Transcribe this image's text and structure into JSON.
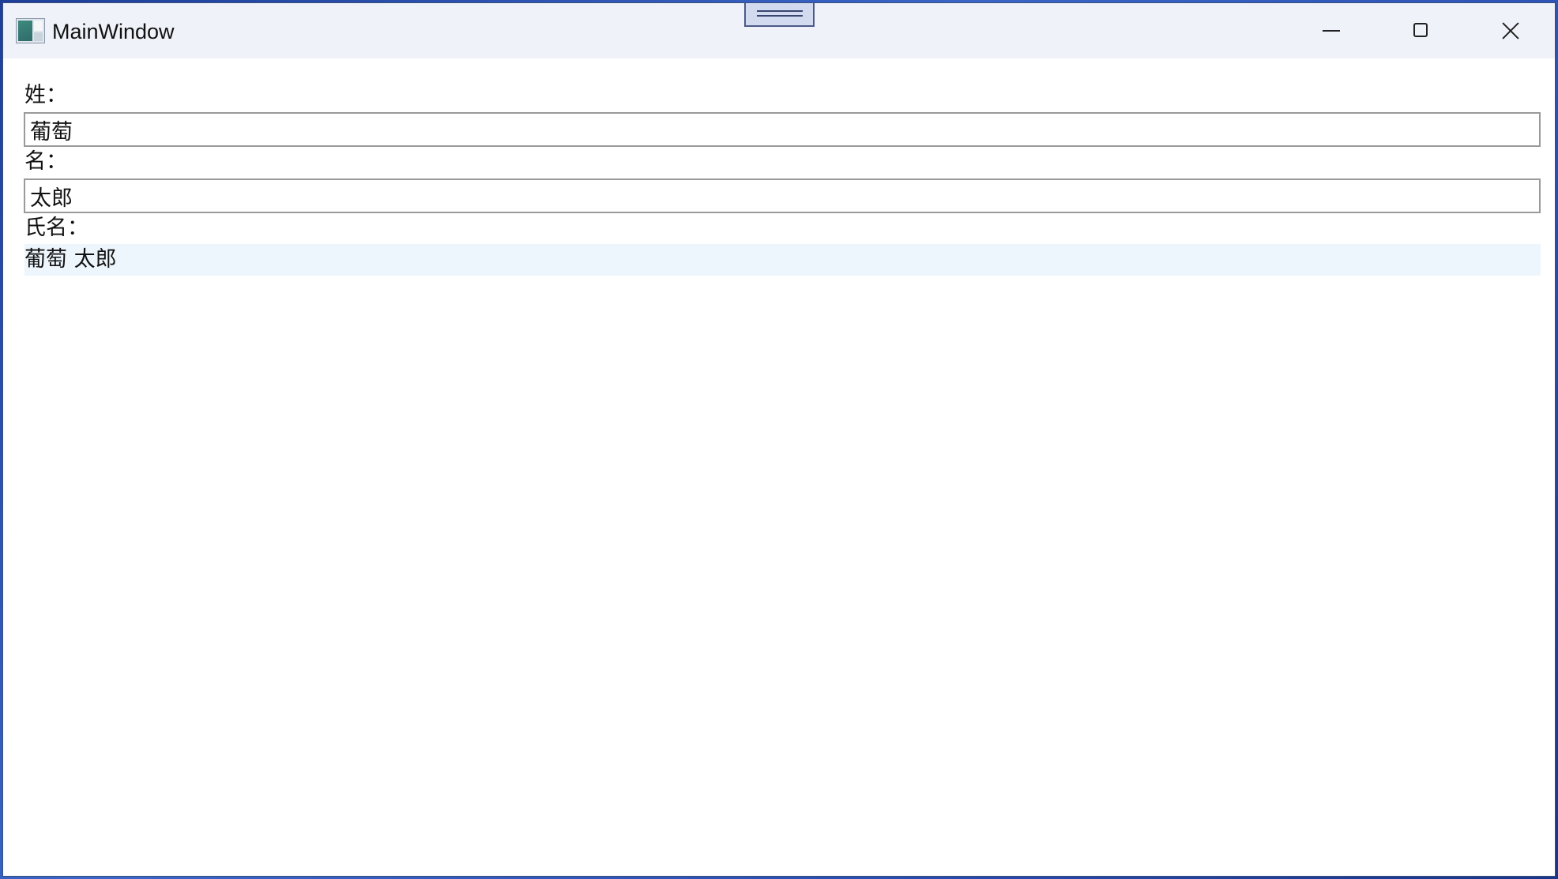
{
  "window": {
    "title": "MainWindow"
  },
  "form": {
    "last_name_label": "姓：",
    "last_name_value": "葡萄",
    "first_name_label": "名：",
    "first_name_value": "太郎",
    "full_name_label": "氏名：",
    "full_name_value": "葡萄 太郎"
  },
  "icons": {
    "app": "app-window-icon",
    "minimize": "minimize-icon",
    "maximize": "maximize-icon",
    "close": "close-icon",
    "handle": "drag-handle-icon"
  }
}
